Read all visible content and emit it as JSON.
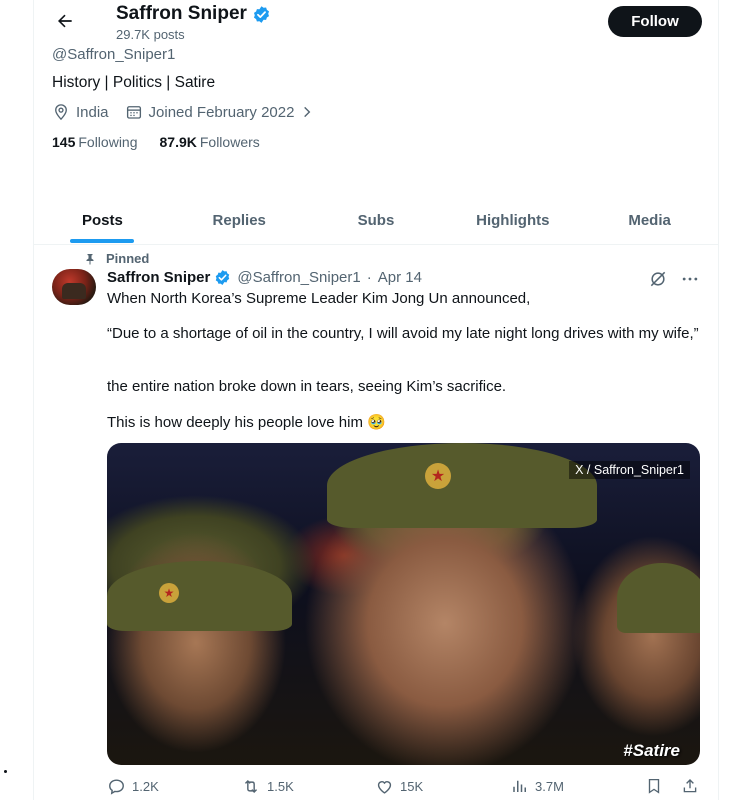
{
  "header": {
    "title": "Saffron Sniper",
    "post_count": "29.7K posts",
    "follow_label": "Follow"
  },
  "profile": {
    "handle": "@Saffron_Sniper1",
    "bio": "History | Politics | Satire",
    "location": "India",
    "joined": "Joined February 2022",
    "following_count": "145",
    "following_label": "Following",
    "followers_count": "87.9K",
    "followers_label": "Followers"
  },
  "tabs": [
    {
      "label": "Posts",
      "active": true
    },
    {
      "label": "Replies",
      "active": false
    },
    {
      "label": "Subs",
      "active": false
    },
    {
      "label": "Highlights",
      "active": false
    },
    {
      "label": "Media",
      "active": false
    }
  ],
  "tweet": {
    "pinned_label": "Pinned",
    "author_name": "Saffron Sniper",
    "author_handle": "@Saffron_Sniper1",
    "separator": "·",
    "date": "Apr 14",
    "lines": [
      "When North Korea’s Supreme Leader Kim Jong Un announced,",
      "“Due to a shortage of oil in the country, I will avoid my late night long drives with my wife,”",
      "the entire nation broke down in tears, seeing Kim’s sacrifice.",
      "This is how deeply his people love him 🥹"
    ],
    "media_watermark": "X / Saffron_Sniper1",
    "media_caption": "#Satire",
    "stats": {
      "replies": "1.2K",
      "reposts": "1.5K",
      "likes": "15K",
      "views": "3.7M"
    }
  },
  "colors": {
    "accent": "#1d9bf0",
    "text_primary": "#0f1419",
    "text_secondary": "#536471",
    "verified": "#1d9bf0"
  }
}
